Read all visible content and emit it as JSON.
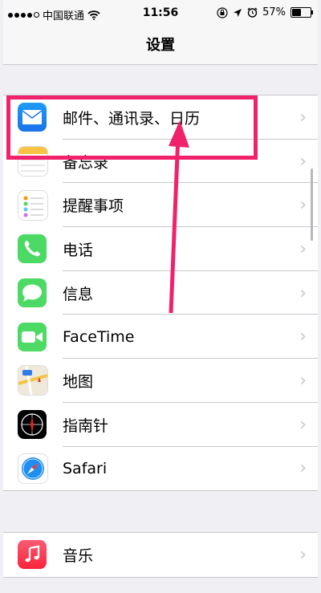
{
  "status": {
    "carrier": "中国联通",
    "time": "11:56",
    "battery": "57%",
    "battery_level": 0.57
  },
  "nav": {
    "title": "设置"
  },
  "rows": [
    {
      "label": "邮件、通讯录、日历",
      "icon": "mail-icon"
    },
    {
      "label": "备忘录",
      "icon": "notes-icon"
    },
    {
      "label": "提醒事项",
      "icon": "reminders-icon"
    },
    {
      "label": "电话",
      "icon": "phone-icon"
    },
    {
      "label": "信息",
      "icon": "messages-icon"
    },
    {
      "label": "FaceTime",
      "icon": "facetime-icon"
    },
    {
      "label": "地图",
      "icon": "maps-icon"
    },
    {
      "label": "指南针",
      "icon": "compass-icon"
    },
    {
      "label": "Safari",
      "icon": "safari-icon"
    }
  ],
  "rows2": [
    {
      "label": "音乐",
      "icon": "music-icon"
    }
  ],
  "colors": {
    "highlight": "#f0226b",
    "green": "#4cd964",
    "blue": "#1a72ea"
  }
}
